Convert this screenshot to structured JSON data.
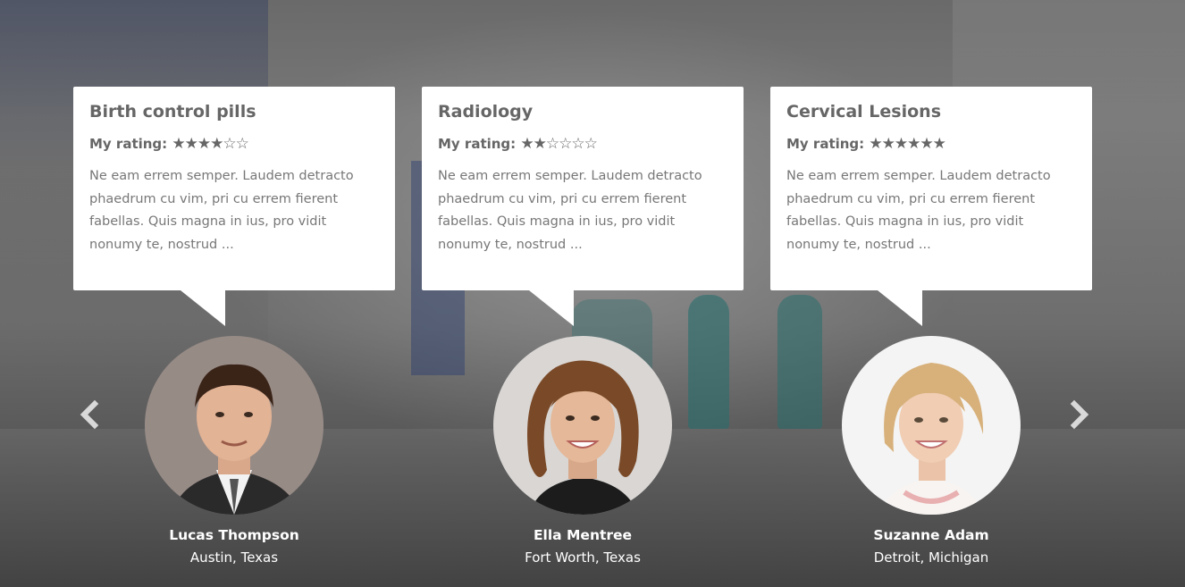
{
  "testimonials": [
    {
      "title": "Birth control pills",
      "rating_label": "My rating:",
      "rating_stars": "★★★★☆☆",
      "rating": 4,
      "rating_max": 6,
      "excerpt": "Ne eam errem semper. Laudem detracto phaedrum cu vim, pri cu errem fierent fabellas. Quis magna in ius, pro vidit nonumy te, nostrud ...",
      "name": "Lucas Thompson",
      "location": "Austin, Texas"
    },
    {
      "title": "Radiology",
      "rating_label": "My rating:",
      "rating_stars": "★★☆☆☆☆",
      "rating": 2,
      "rating_max": 6,
      "excerpt": "Ne eam errem semper. Laudem detracto phaedrum cu vim, pri cu errem fierent fabellas. Quis magna in ius, pro vidit nonumy te, nostrud ...",
      "name": "Ella Mentree",
      "location": "Fort Worth, Texas"
    },
    {
      "title": "Cervical Lesions",
      "rating_label": "My rating:",
      "rating_stars": "★★★★★★",
      "rating": 6,
      "rating_max": 6,
      "excerpt": "Ne eam errem semper. Laudem detracto phaedrum cu vim, pri cu errem fierent fabellas. Quis magna in ius, pro vidit nonumy te, nostrud ...",
      "name": "Suzanne Adam",
      "location": "Detroit, Michigan"
    }
  ],
  "navigation": {
    "prev_icon": "chevron-left-icon",
    "next_icon": "chevron-right-icon"
  },
  "colors": {
    "card_background": "#ffffff",
    "text_dark": "#666666",
    "text_body": "#777777",
    "overlay_text": "#ffffff"
  }
}
